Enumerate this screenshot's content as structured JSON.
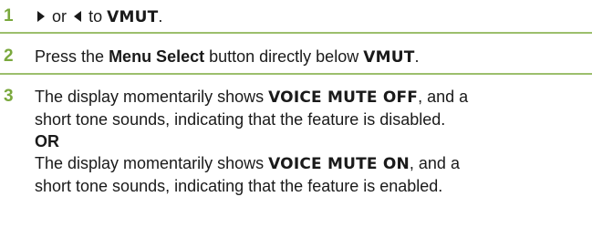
{
  "steps": [
    {
      "number": "1",
      "or_text": "or",
      "to_text": "to",
      "target": "VMUT",
      "end": ".",
      "arrow_right_icon": "right-arrow-key",
      "arrow_left_icon": "left-arrow-key"
    },
    {
      "number": "2",
      "prefix": "Press the",
      "button": "Menu Select",
      "middle": "button directly below",
      "target": "VMUT",
      "end": "."
    },
    {
      "number": "3",
      "line1_prefix": "The display momentarily shows",
      "display_off": "VOICE MUTE OFF",
      "line1_suffix": ", and a",
      "line2": "short tone sounds, indicating that the feature is disabled.",
      "or": "OR",
      "line4_prefix": "The display momentarily shows",
      "display_on": "VOICE MUTE ON",
      "line4_suffix": ", and a",
      "line5": "short tone sounds, indicating that the feature is enabled."
    }
  ],
  "colors": {
    "step_number": "#7aa83d",
    "divider": "#9cbf6d",
    "text": "#1a1a1a"
  }
}
